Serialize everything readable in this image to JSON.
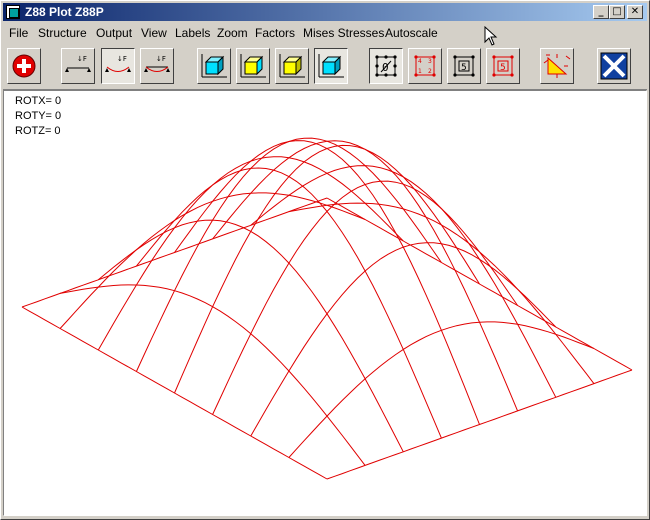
{
  "window": {
    "title": "Z88 Plot Z88P",
    "controls": {
      "minimize": "_",
      "maximize": "□",
      "close": "✕"
    }
  },
  "menu": [
    "File",
    "Structure",
    "Output",
    "View",
    "Labels",
    "Zoom",
    "Factors",
    "Mises Stresses",
    "Autoscale"
  ],
  "toolbar": {
    "buttons": [
      {
        "name": "add-button",
        "icon": "red-cross-icon"
      },
      {
        "name": "undeformed-structure-button",
        "icon": "beam-icon"
      },
      {
        "name": "deformed-structure-button",
        "icon": "beam-deformed-icon",
        "pressed": true
      },
      {
        "name": "both-structures-button",
        "icon": "beam-both-icon"
      },
      {
        "name": "view-1-button",
        "icon": "cube-icon"
      },
      {
        "name": "view-2-button",
        "icon": "cube-icon"
      },
      {
        "name": "view-3-button",
        "icon": "cube-icon"
      },
      {
        "name": "view-4-button",
        "icon": "cube-icon",
        "pressed": true
      },
      {
        "name": "no-labels-button",
        "icon": "label-none-icon",
        "pressed": true
      },
      {
        "name": "node-labels-button",
        "icon": "label-nodes-icon"
      },
      {
        "name": "element-labels-button",
        "icon": "label-elements-icon"
      },
      {
        "name": "all-labels-button",
        "icon": "label-all-icon"
      },
      {
        "name": "stresses-button",
        "icon": "stress-triangle-icon"
      },
      {
        "name": "exit-button",
        "icon": "exit-icon"
      }
    ],
    "element_label_digit": "5",
    "no_label_digit": "0",
    "node_digits": [
      "4",
      "3",
      "1",
      "2"
    ]
  },
  "readouts": {
    "rotx": "ROTX= 0",
    "roty": "ROTY= 0",
    "rotz": "ROTZ= 0"
  },
  "mesh": {
    "color": "#e00000",
    "divisions": 8,
    "surface": "dome"
  }
}
